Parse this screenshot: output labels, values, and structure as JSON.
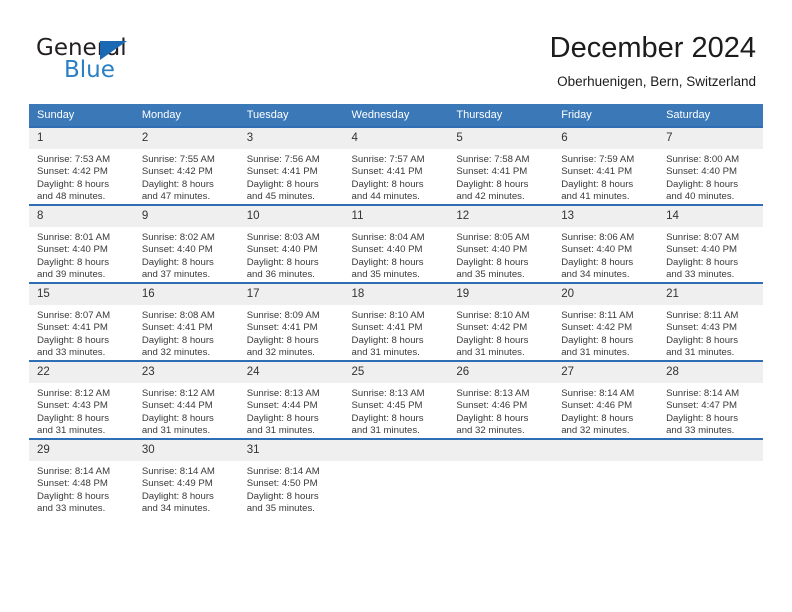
{
  "brand": {
    "name_part1": "General",
    "name_part2": "Blue",
    "accent_color": "#2a7fc4",
    "triangle_color": "#1b69b3"
  },
  "header": {
    "title": "December 2024",
    "subtitle": "Oberhuenigen, Bern, Switzerland"
  },
  "calendar": {
    "header_bg": "#3b78b8",
    "row_border_color": "#2f6eb5",
    "daynum_bg": "#efefef",
    "weekdays": [
      "Sunday",
      "Monday",
      "Tuesday",
      "Wednesday",
      "Thursday",
      "Friday",
      "Saturday"
    ],
    "weeks": [
      [
        {
          "day": "1",
          "sunrise": "Sunrise: 7:53 AM",
          "sunset": "Sunset: 4:42 PM",
          "daylight_line1": "Daylight: 8 hours",
          "daylight_line2": "and 48 minutes."
        },
        {
          "day": "2",
          "sunrise": "Sunrise: 7:55 AM",
          "sunset": "Sunset: 4:42 PM",
          "daylight_line1": "Daylight: 8 hours",
          "daylight_line2": "and 47 minutes."
        },
        {
          "day": "3",
          "sunrise": "Sunrise: 7:56 AM",
          "sunset": "Sunset: 4:41 PM",
          "daylight_line1": "Daylight: 8 hours",
          "daylight_line2": "and 45 minutes."
        },
        {
          "day": "4",
          "sunrise": "Sunrise: 7:57 AM",
          "sunset": "Sunset: 4:41 PM",
          "daylight_line1": "Daylight: 8 hours",
          "daylight_line2": "and 44 minutes."
        },
        {
          "day": "5",
          "sunrise": "Sunrise: 7:58 AM",
          "sunset": "Sunset: 4:41 PM",
          "daylight_line1": "Daylight: 8 hours",
          "daylight_line2": "and 42 minutes."
        },
        {
          "day": "6",
          "sunrise": "Sunrise: 7:59 AM",
          "sunset": "Sunset: 4:41 PM",
          "daylight_line1": "Daylight: 8 hours",
          "daylight_line2": "and 41 minutes."
        },
        {
          "day": "7",
          "sunrise": "Sunrise: 8:00 AM",
          "sunset": "Sunset: 4:40 PM",
          "daylight_line1": "Daylight: 8 hours",
          "daylight_line2": "and 40 minutes."
        }
      ],
      [
        {
          "day": "8",
          "sunrise": "Sunrise: 8:01 AM",
          "sunset": "Sunset: 4:40 PM",
          "daylight_line1": "Daylight: 8 hours",
          "daylight_line2": "and 39 minutes."
        },
        {
          "day": "9",
          "sunrise": "Sunrise: 8:02 AM",
          "sunset": "Sunset: 4:40 PM",
          "daylight_line1": "Daylight: 8 hours",
          "daylight_line2": "and 37 minutes."
        },
        {
          "day": "10",
          "sunrise": "Sunrise: 8:03 AM",
          "sunset": "Sunset: 4:40 PM",
          "daylight_line1": "Daylight: 8 hours",
          "daylight_line2": "and 36 minutes."
        },
        {
          "day": "11",
          "sunrise": "Sunrise: 8:04 AM",
          "sunset": "Sunset: 4:40 PM",
          "daylight_line1": "Daylight: 8 hours",
          "daylight_line2": "and 35 minutes."
        },
        {
          "day": "12",
          "sunrise": "Sunrise: 8:05 AM",
          "sunset": "Sunset: 4:40 PM",
          "daylight_line1": "Daylight: 8 hours",
          "daylight_line2": "and 35 minutes."
        },
        {
          "day": "13",
          "sunrise": "Sunrise: 8:06 AM",
          "sunset": "Sunset: 4:40 PM",
          "daylight_line1": "Daylight: 8 hours",
          "daylight_line2": "and 34 minutes."
        },
        {
          "day": "14",
          "sunrise": "Sunrise: 8:07 AM",
          "sunset": "Sunset: 4:40 PM",
          "daylight_line1": "Daylight: 8 hours",
          "daylight_line2": "and 33 minutes."
        }
      ],
      [
        {
          "day": "15",
          "sunrise": "Sunrise: 8:07 AM",
          "sunset": "Sunset: 4:41 PM",
          "daylight_line1": "Daylight: 8 hours",
          "daylight_line2": "and 33 minutes."
        },
        {
          "day": "16",
          "sunrise": "Sunrise: 8:08 AM",
          "sunset": "Sunset: 4:41 PM",
          "daylight_line1": "Daylight: 8 hours",
          "daylight_line2": "and 32 minutes."
        },
        {
          "day": "17",
          "sunrise": "Sunrise: 8:09 AM",
          "sunset": "Sunset: 4:41 PM",
          "daylight_line1": "Daylight: 8 hours",
          "daylight_line2": "and 32 minutes."
        },
        {
          "day": "18",
          "sunrise": "Sunrise: 8:10 AM",
          "sunset": "Sunset: 4:41 PM",
          "daylight_line1": "Daylight: 8 hours",
          "daylight_line2": "and 31 minutes."
        },
        {
          "day": "19",
          "sunrise": "Sunrise: 8:10 AM",
          "sunset": "Sunset: 4:42 PM",
          "daylight_line1": "Daylight: 8 hours",
          "daylight_line2": "and 31 minutes."
        },
        {
          "day": "20",
          "sunrise": "Sunrise: 8:11 AM",
          "sunset": "Sunset: 4:42 PM",
          "daylight_line1": "Daylight: 8 hours",
          "daylight_line2": "and 31 minutes."
        },
        {
          "day": "21",
          "sunrise": "Sunrise: 8:11 AM",
          "sunset": "Sunset: 4:43 PM",
          "daylight_line1": "Daylight: 8 hours",
          "daylight_line2": "and 31 minutes."
        }
      ],
      [
        {
          "day": "22",
          "sunrise": "Sunrise: 8:12 AM",
          "sunset": "Sunset: 4:43 PM",
          "daylight_line1": "Daylight: 8 hours",
          "daylight_line2": "and 31 minutes."
        },
        {
          "day": "23",
          "sunrise": "Sunrise: 8:12 AM",
          "sunset": "Sunset: 4:44 PM",
          "daylight_line1": "Daylight: 8 hours",
          "daylight_line2": "and 31 minutes."
        },
        {
          "day": "24",
          "sunrise": "Sunrise: 8:13 AM",
          "sunset": "Sunset: 4:44 PM",
          "daylight_line1": "Daylight: 8 hours",
          "daylight_line2": "and 31 minutes."
        },
        {
          "day": "25",
          "sunrise": "Sunrise: 8:13 AM",
          "sunset": "Sunset: 4:45 PM",
          "daylight_line1": "Daylight: 8 hours",
          "daylight_line2": "and 31 minutes."
        },
        {
          "day": "26",
          "sunrise": "Sunrise: 8:13 AM",
          "sunset": "Sunset: 4:46 PM",
          "daylight_line1": "Daylight: 8 hours",
          "daylight_line2": "and 32 minutes."
        },
        {
          "day": "27",
          "sunrise": "Sunrise: 8:14 AM",
          "sunset": "Sunset: 4:46 PM",
          "daylight_line1": "Daylight: 8 hours",
          "daylight_line2": "and 32 minutes."
        },
        {
          "day": "28",
          "sunrise": "Sunrise: 8:14 AM",
          "sunset": "Sunset: 4:47 PM",
          "daylight_line1": "Daylight: 8 hours",
          "daylight_line2": "and 33 minutes."
        }
      ],
      [
        {
          "day": "29",
          "sunrise": "Sunrise: 8:14 AM",
          "sunset": "Sunset: 4:48 PM",
          "daylight_line1": "Daylight: 8 hours",
          "daylight_line2": "and 33 minutes."
        },
        {
          "day": "30",
          "sunrise": "Sunrise: 8:14 AM",
          "sunset": "Sunset: 4:49 PM",
          "daylight_line1": "Daylight: 8 hours",
          "daylight_line2": "and 34 minutes."
        },
        {
          "day": "31",
          "sunrise": "Sunrise: 8:14 AM",
          "sunset": "Sunset: 4:50 PM",
          "daylight_line1": "Daylight: 8 hours",
          "daylight_line2": "and 35 minutes."
        },
        {
          "day": "",
          "sunrise": "",
          "sunset": "",
          "daylight_line1": "",
          "daylight_line2": ""
        },
        {
          "day": "",
          "sunrise": "",
          "sunset": "",
          "daylight_line1": "",
          "daylight_line2": ""
        },
        {
          "day": "",
          "sunrise": "",
          "sunset": "",
          "daylight_line1": "",
          "daylight_line2": ""
        },
        {
          "day": "",
          "sunrise": "",
          "sunset": "",
          "daylight_line1": "",
          "daylight_line2": ""
        }
      ]
    ]
  }
}
